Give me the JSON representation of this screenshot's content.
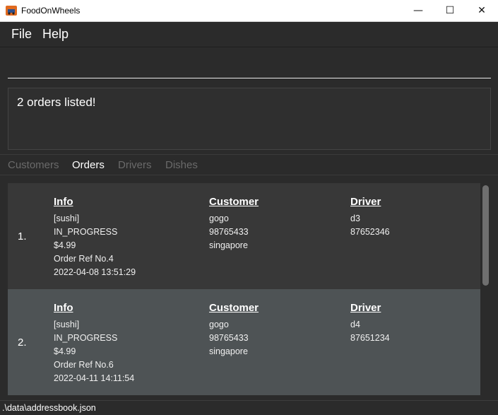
{
  "window": {
    "title": "FoodOnWheels",
    "min": "—",
    "max": "☐",
    "close": "✕"
  },
  "menu": [
    {
      "label": "File"
    },
    {
      "label": "Help"
    }
  ],
  "command": {
    "value": "",
    "placeholder": ""
  },
  "result": {
    "text": "2 orders listed!"
  },
  "tabs": [
    {
      "label": "Customers",
      "active": false
    },
    {
      "label": "Orders",
      "active": true
    },
    {
      "label": "Drivers",
      "active": false
    },
    {
      "label": "Dishes",
      "active": false
    }
  ],
  "orders": [
    {
      "index": "1.",
      "info_header": "Info",
      "info": [
        "[sushi]",
        "IN_PROGRESS",
        "$4.99",
        "Order Ref No.4",
        "2022-04-08 13:51:29"
      ],
      "customer_header": "Customer",
      "customer": [
        "gogo",
        "98765433",
        "singapore"
      ],
      "driver_header": "Driver",
      "driver": [
        "d3",
        "87652346"
      ]
    },
    {
      "index": "2.",
      "info_header": "Info",
      "info": [
        "[sushi]",
        "IN_PROGRESS",
        "$4.99",
        "Order Ref No.6",
        "2022-04-11 14:11:54"
      ],
      "customer_header": "Customer",
      "customer": [
        "gogo",
        "98765433",
        "singapore"
      ],
      "driver_header": "Driver",
      "driver": [
        "d4",
        "87651234"
      ]
    }
  ],
  "status": {
    "path": ".\\data\\addressbook.json"
  }
}
